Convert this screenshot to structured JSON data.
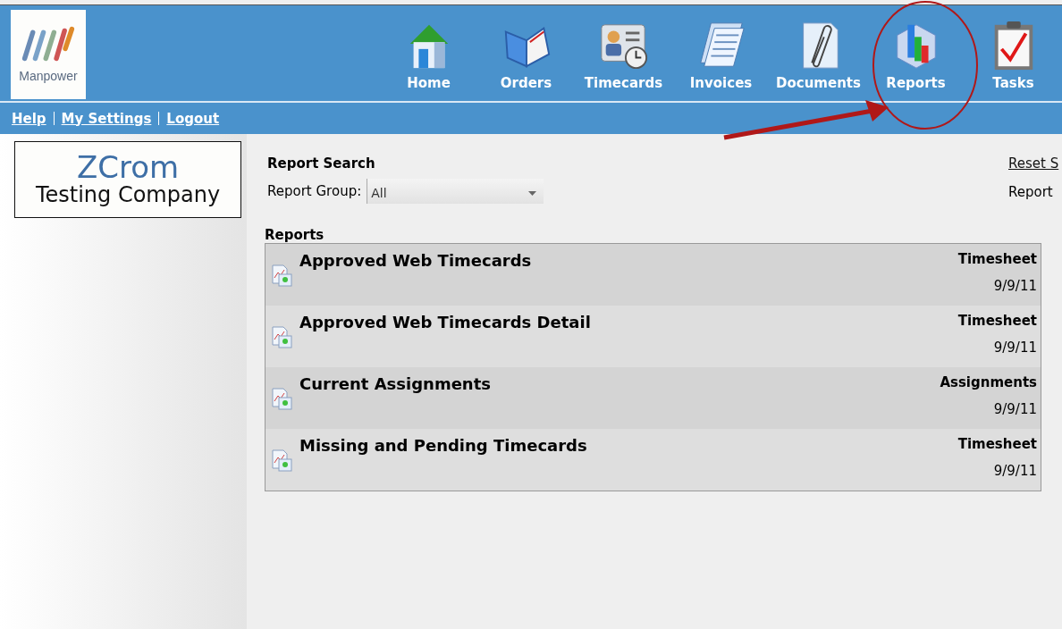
{
  "brand": {
    "name": "Manpower"
  },
  "nav": [
    {
      "label": "Home",
      "kind": "home"
    },
    {
      "label": "Orders",
      "kind": "orders"
    },
    {
      "label": "Timecards",
      "kind": "timecards"
    },
    {
      "label": "Invoices",
      "kind": "invoices"
    },
    {
      "label": "Documents",
      "kind": "documents"
    },
    {
      "label": "Reports",
      "kind": "reports"
    },
    {
      "label": "Tasks",
      "kind": "tasks"
    }
  ],
  "links": [
    "Help",
    "My Settings",
    "Logout"
  ],
  "company": {
    "name": "ZCrom",
    "subtitle": "Testing Company"
  },
  "search": {
    "title": "Report Search",
    "group_label": "Report Group:",
    "group_value": "All",
    "reset_link": "Reset S",
    "side_text": "Report"
  },
  "reports": {
    "title": "Reports",
    "rows": [
      {
        "name": "Approved Web Timecards",
        "category": "Timesheet",
        "date": "9/9/11"
      },
      {
        "name": "Approved Web Timecards Detail",
        "category": "Timesheet",
        "date": "9/9/11"
      },
      {
        "name": "Current Assignments",
        "category": "Assignments",
        "date": "9/9/11"
      },
      {
        "name": "Missing and Pending Timecards",
        "category": "Timesheet",
        "date": "9/9/11"
      }
    ]
  }
}
